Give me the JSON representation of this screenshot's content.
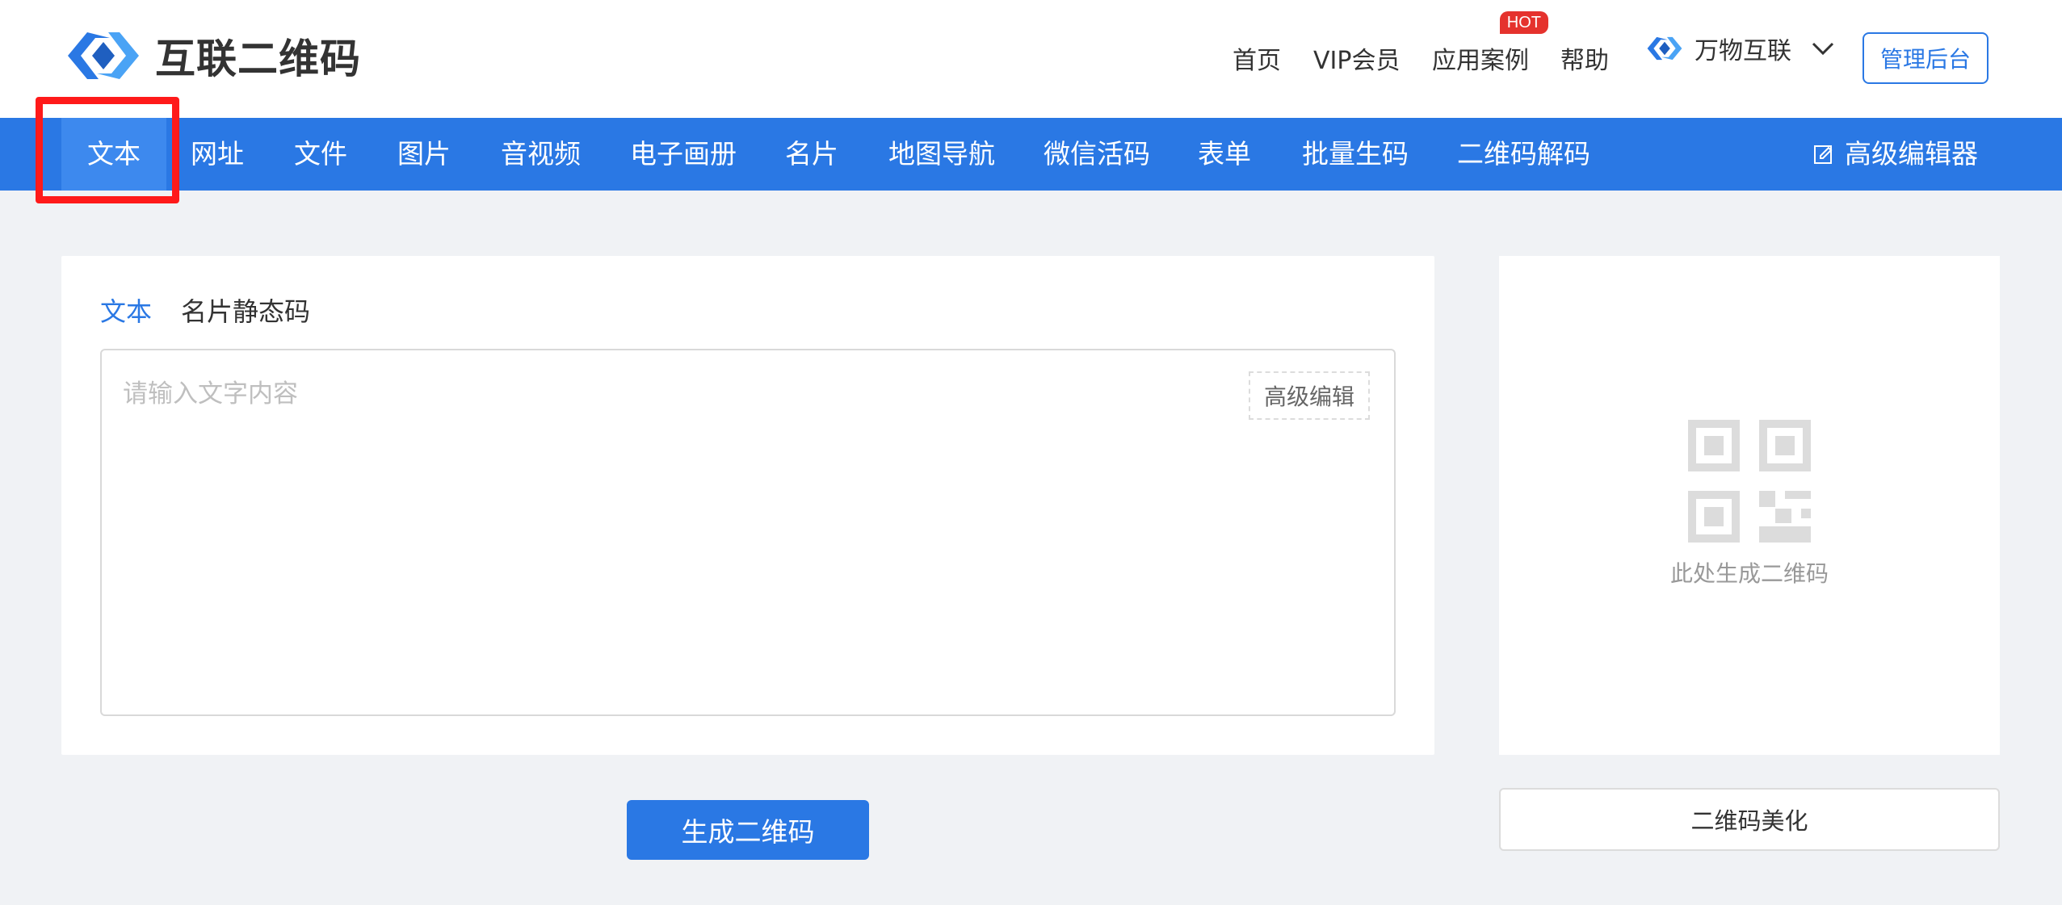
{
  "header": {
    "logo_text": "互联二维码",
    "nav": {
      "home": "首页",
      "vip": "VIP会员",
      "cases": "应用案例",
      "cases_badge": "HOT",
      "help": "帮助",
      "brand": "万物互联"
    },
    "admin_button": "管理后台"
  },
  "navbar": {
    "items": [
      "文本",
      "网址",
      "文件",
      "图片",
      "音视频",
      "电子画册",
      "名片",
      "地图导航",
      "微信活码",
      "表单",
      "批量生码",
      "二维码解码"
    ],
    "advanced_editor": "高级编辑器"
  },
  "editor": {
    "tabs": [
      "文本",
      "名片静态码"
    ],
    "placeholder": "请输入文字内容",
    "advanced_edit": "高级编辑"
  },
  "generate_button": "生成二维码",
  "preview": {
    "text": "此处生成二维码",
    "beautify_button": "二维码美化"
  },
  "colors": {
    "primary": "#2a78e4",
    "highlight": "#ff1a1a",
    "hot_badge": "#e5322d",
    "page_bg": "#f0f2f5"
  }
}
